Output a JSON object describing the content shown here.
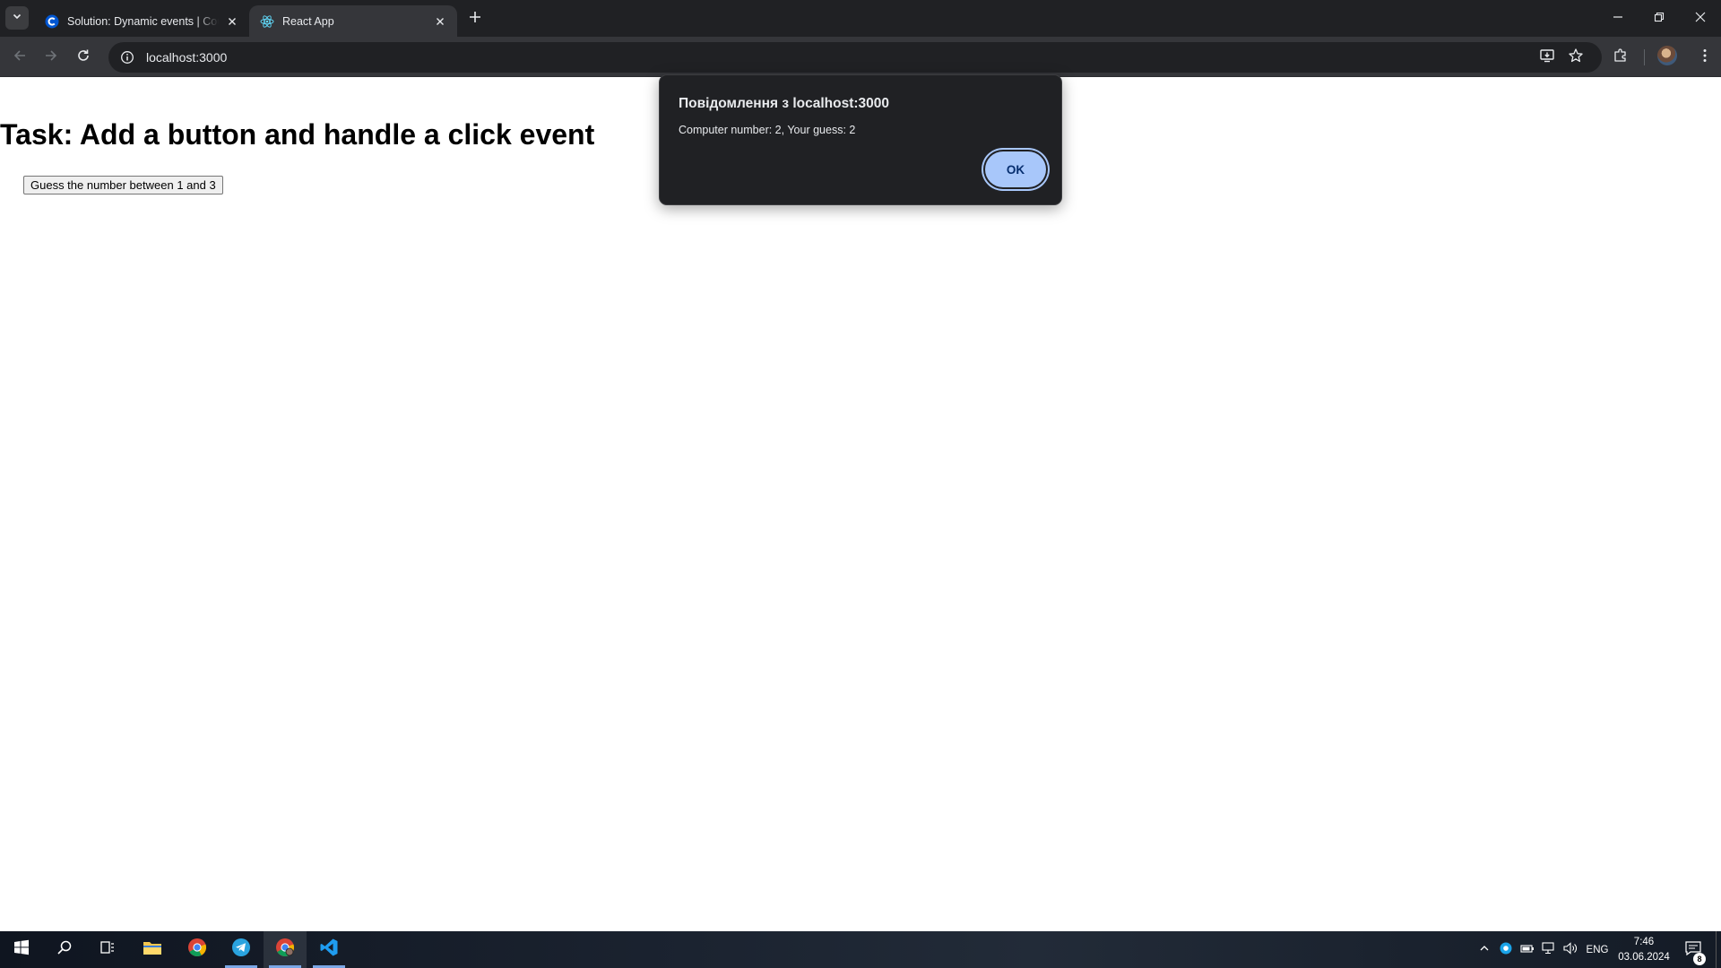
{
  "browser": {
    "tabs": [
      {
        "title": "Solution: Dynamic events | Cou",
        "favicon": "coursera-c-icon",
        "active": false
      },
      {
        "title": "React App",
        "favicon": "react-atom-icon",
        "active": true
      }
    ],
    "url": "localhost:3000"
  },
  "page": {
    "heading": "Task: Add a button and handle a click event",
    "button_label": "Guess the number between 1 and 3"
  },
  "dialog": {
    "title": "Повідомлення з localhost:3000",
    "message": "Computer number: 2, Your guess: 2",
    "ok_label": "OK"
  },
  "taskbar": {
    "language": "ENG",
    "time": "7:46",
    "date": "03.06.2024",
    "notification_count": "8",
    "apps": [
      "windows-start-icon",
      "search-icon",
      "task-view-icon",
      "file-explorer-icon",
      "chrome-icon",
      "telegram-icon",
      "chrome-profile-icon",
      "vscode-icon"
    ]
  },
  "colors": {
    "chrome_dark": "#202124",
    "toolbar": "#35363a",
    "dialog_button": "#a8c7fa"
  }
}
